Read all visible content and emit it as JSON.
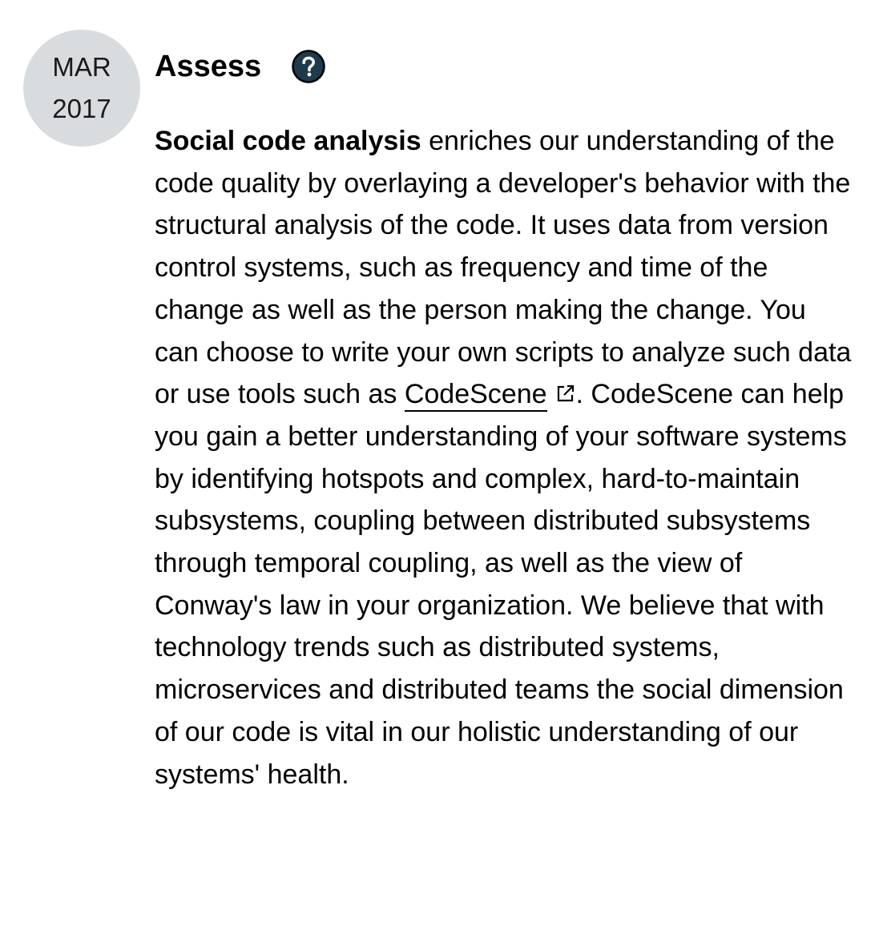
{
  "date_badge": {
    "month": "MAR",
    "year": "2017"
  },
  "header": {
    "ring": "Assess",
    "help_icon": "help-circle-icon"
  },
  "blip": {
    "title": "Social code analysis",
    "text_before_link": " enriches our understanding of the code quality by overlaying a developer's behavior with the structural analysis of the code. It uses data from version control systems, such as frequency and time of the change as well as the person making the change. You can choose to write your own scripts to analyze such data or use tools such as ",
    "link_text": "CodeScene",
    "link_icon": "external-link-icon",
    "text_after_link": ". CodeScene can help you gain a better understanding of your software systems by identifying hotspots and complex, hard-to-maintain subsystems, coupling between distributed subsystems through temporal coupling, as well as the view of Conway's law in your organization. We believe that with technology trends such as distributed systems, microservices and distributed teams the social dimension of our code is vital in our holistic understanding of our systems' health."
  },
  "colors": {
    "badge_background": "#d9dcdf",
    "help_icon_fill": "#1e3a4c",
    "text": "#000000"
  }
}
